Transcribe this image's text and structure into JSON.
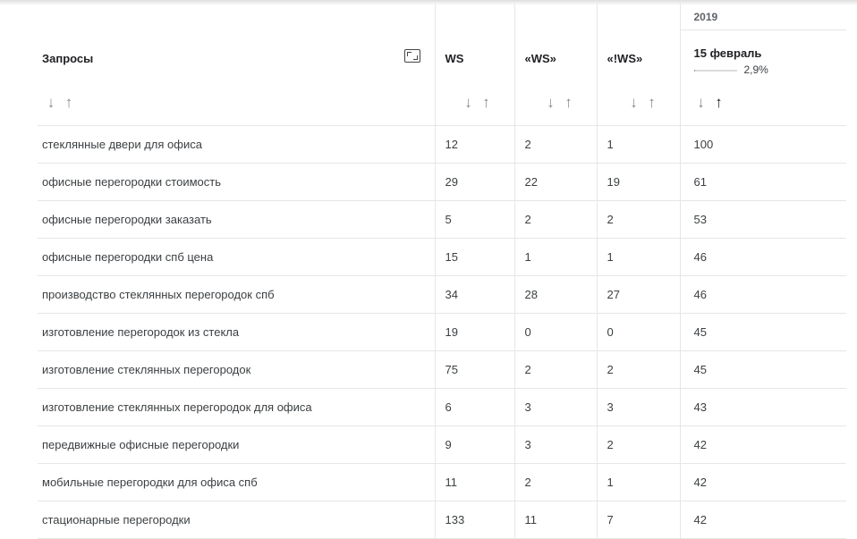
{
  "table": {
    "headers": {
      "query": "Запросы",
      "ws": "WS",
      "ws_quoted": "«WS»",
      "ws_exact": "«!WS»",
      "year": "2019",
      "date": "15 февраль",
      "date_trend_percent": "2,9%",
      "date_trend_fill": 0.03
    },
    "sort_down_glyph": "↓",
    "sort_up_glyph": "↑",
    "icons": {
      "expand": "expand-icon",
      "sort_down": "arrow-down-icon",
      "sort_up": "arrow-up-icon"
    },
    "rows": [
      {
        "query": "стеклянные двери для офиса",
        "ws": "12",
        "ws_quoted": "2",
        "ws_exact": "1",
        "date": "100"
      },
      {
        "query": "офисные перегородки стоимость",
        "ws": "29",
        "ws_quoted": "22",
        "ws_exact": "19",
        "date": "61"
      },
      {
        "query": "офисные перегородки заказать",
        "ws": "5",
        "ws_quoted": "2",
        "ws_exact": "2",
        "date": "53"
      },
      {
        "query": "офисные перегородки спб цена",
        "ws": "15",
        "ws_quoted": "1",
        "ws_exact": "1",
        "date": "46"
      },
      {
        "query": "производство стеклянных перегородок спб",
        "ws": "34",
        "ws_quoted": "28",
        "ws_exact": "27",
        "date": "46"
      },
      {
        "query": "изготовление перегородок из стекла",
        "ws": "19",
        "ws_quoted": "0",
        "ws_exact": "0",
        "date": "45"
      },
      {
        "query": "изготовление стеклянных перегородок",
        "ws": "75",
        "ws_quoted": "2",
        "ws_exact": "2",
        "date": "45"
      },
      {
        "query": "изготовление стеклянных перегородок для офиса",
        "ws": "6",
        "ws_quoted": "3",
        "ws_exact": "3",
        "date": "43"
      },
      {
        "query": "передвижные офисные перегородки",
        "ws": "9",
        "ws_quoted": "3",
        "ws_exact": "2",
        "date": "42"
      },
      {
        "query": "мобильные перегородки для офиса спб",
        "ws": "11",
        "ws_quoted": "2",
        "ws_exact": "1",
        "date": "42"
      },
      {
        "query": "стационарные перегородки",
        "ws": "133",
        "ws_quoted": "11",
        "ws_exact": "7",
        "date": "42"
      }
    ]
  }
}
